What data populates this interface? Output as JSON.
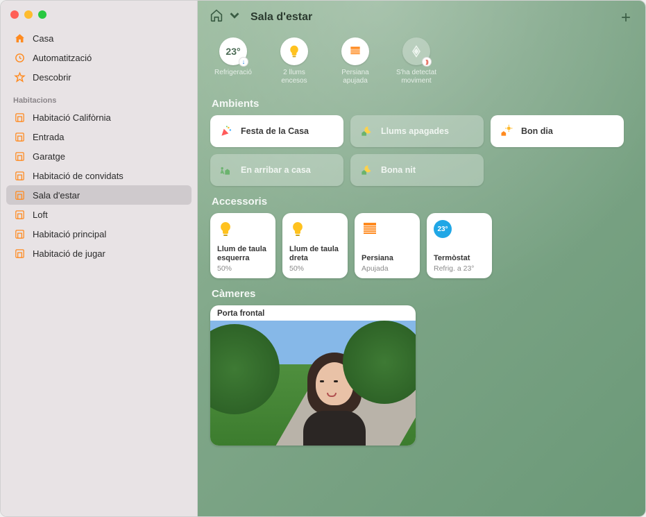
{
  "sidebar": {
    "top": [
      {
        "icon": "home-icon",
        "label": "Casa"
      },
      {
        "icon": "clock-icon",
        "label": "Automatització"
      },
      {
        "icon": "star-icon",
        "label": "Descobrir"
      }
    ],
    "section_header": "Habitacions",
    "rooms": [
      {
        "label": "Habitació Califòrnia"
      },
      {
        "label": "Entrada"
      },
      {
        "label": "Garatge"
      },
      {
        "label": "Habitació de convidats"
      },
      {
        "label": "Sala d'estar",
        "selected": true
      },
      {
        "label": "Loft"
      },
      {
        "label": "Habitació principal"
      },
      {
        "label": "Habitació de jugar"
      }
    ]
  },
  "header": {
    "title": "Sala d'estar"
  },
  "status": [
    {
      "kind": "temp",
      "value": "23°",
      "caption": "Refrigeració",
      "badge": "blue"
    },
    {
      "kind": "bulb",
      "caption": "2 llums encesos"
    },
    {
      "kind": "blind",
      "caption": "Persiana apujada"
    },
    {
      "kind": "motion",
      "caption": "S'ha detectat moviment",
      "badge": "red",
      "dim": true
    }
  ],
  "sections": {
    "scenes_title": "Ambients",
    "accessories_title": "Accessoris",
    "cameras_title": "Càmeres"
  },
  "scenes": [
    {
      "label": "Festa de la Casa",
      "variant": "light",
      "icon": "party-icon"
    },
    {
      "label": "Llums apagades",
      "variant": "dark",
      "icon": "moon-home-icon"
    },
    {
      "label": "Bon dia",
      "variant": "light",
      "icon": "sun-home-icon"
    },
    {
      "label": "En arribar a casa",
      "variant": "dark",
      "icon": "arrive-home-icon"
    },
    {
      "label": "Bona nit",
      "variant": "dark",
      "icon": "moon-home-icon"
    }
  ],
  "accessories": [
    {
      "name": "Llum de taula esquerra",
      "sub": "50%",
      "icon": "bulb-icon",
      "icon_color": "#ffc21f"
    },
    {
      "name": "Llum de taula dreta",
      "sub": "50%",
      "icon": "bulb-icon",
      "icon_color": "#ffc21f"
    },
    {
      "name": "Persiana",
      "sub": "Apujada",
      "icon": "blind-icon",
      "icon_color": "#ff8a1f"
    },
    {
      "name": "Termòstat",
      "sub": "Refrig. a 23°",
      "icon": "thermo-icon",
      "thermo_value": "23°",
      "icon_color": "#20a7e6"
    }
  ],
  "cameras": [
    {
      "label": "Porta frontal"
    }
  ]
}
